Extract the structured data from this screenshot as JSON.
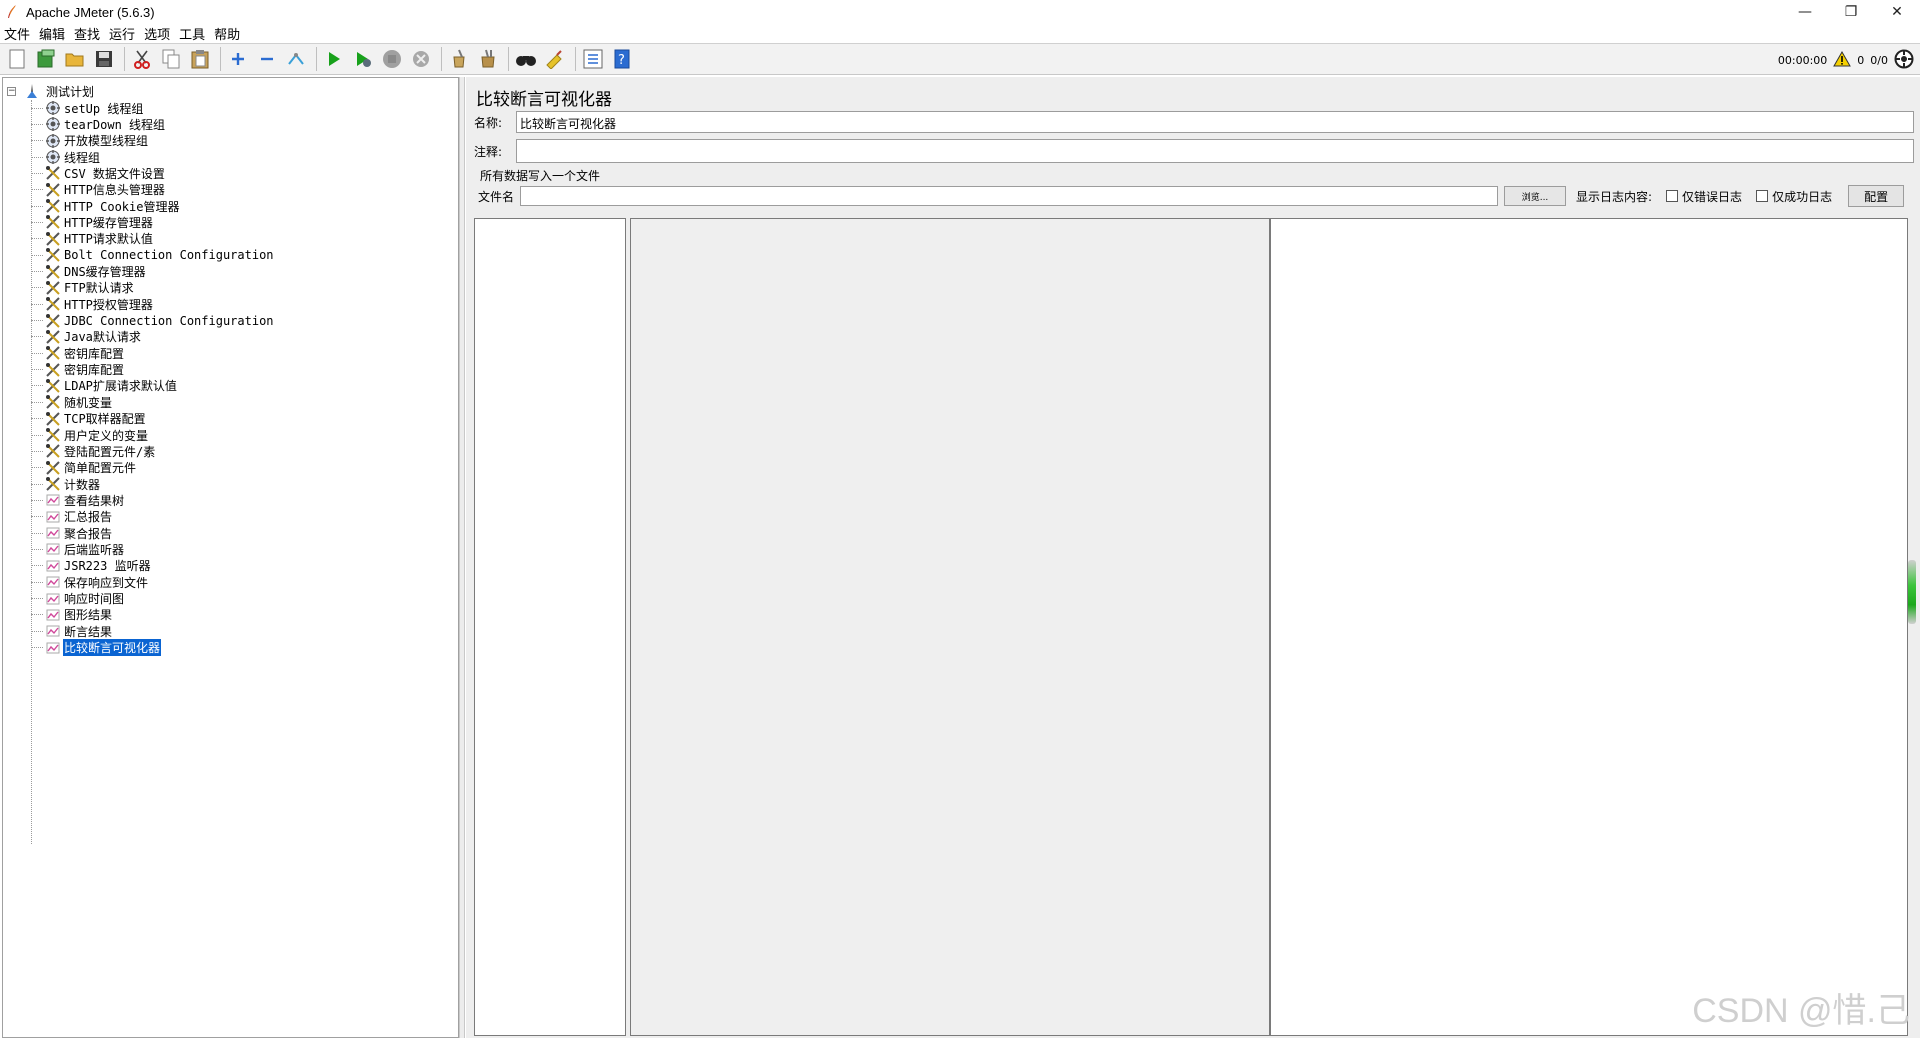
{
  "window": {
    "title": "Apache JMeter (5.6.3)",
    "minimize": "—",
    "restore": "❐",
    "close": "✕"
  },
  "menu": [
    "文件",
    "编辑",
    "查找",
    "运行",
    "选项",
    "工具",
    "帮助"
  ],
  "toolbar": {
    "icons": [
      "new-icon",
      "templates-icon",
      "open-icon",
      "save-icon",
      "cut-icon",
      "copy-icon",
      "paste-icon",
      "expand-icon",
      "collapse-icon",
      "toggle-icon",
      "start-icon",
      "start-no-pause-icon",
      "stop-icon",
      "shutdown-icon",
      "clear-icon",
      "clear-all-icon",
      "search-icon",
      "reset-search-icon",
      "function-helper-icon",
      "help-icon"
    ],
    "timer": "00:00:00",
    "warnings": "0",
    "threads": "0/0"
  },
  "tree": {
    "root": "测试计划",
    "items": [
      {
        "label": "setUp 线程组",
        "icon": "thread-group"
      },
      {
        "label": "tearDown 线程组",
        "icon": "thread-group"
      },
      {
        "label": "开放模型线程组",
        "icon": "thread-group"
      },
      {
        "label": "线程组",
        "icon": "thread-group"
      },
      {
        "label": "CSV 数据文件设置",
        "icon": "config"
      },
      {
        "label": "HTTP信息头管理器",
        "icon": "config"
      },
      {
        "label": "HTTP Cookie管理器",
        "icon": "config"
      },
      {
        "label": "HTTP缓存管理器",
        "icon": "config"
      },
      {
        "label": "HTTP请求默认值",
        "icon": "config"
      },
      {
        "label": "Bolt Connection Configuration",
        "icon": "config"
      },
      {
        "label": "DNS缓存管理器",
        "icon": "config"
      },
      {
        "label": "FTP默认请求",
        "icon": "config"
      },
      {
        "label": "HTTP授权管理器",
        "icon": "config"
      },
      {
        "label": "JDBC Connection Configuration",
        "icon": "config"
      },
      {
        "label": "Java默认请求",
        "icon": "config"
      },
      {
        "label": "密钥库配置",
        "icon": "config"
      },
      {
        "label": "密钥库配置",
        "icon": "config"
      },
      {
        "label": "LDAP扩展请求默认值",
        "icon": "config"
      },
      {
        "label": "随机变量",
        "icon": "config"
      },
      {
        "label": "TCP取样器配置",
        "icon": "config"
      },
      {
        "label": "用户定义的变量",
        "icon": "config"
      },
      {
        "label": "登陆配置元件/素",
        "icon": "config"
      },
      {
        "label": "简单配置元件",
        "icon": "config"
      },
      {
        "label": "计数器",
        "icon": "config"
      },
      {
        "label": "查看结果树",
        "icon": "listener"
      },
      {
        "label": "汇总报告",
        "icon": "listener"
      },
      {
        "label": "聚合报告",
        "icon": "listener"
      },
      {
        "label": "后端监听器",
        "icon": "listener"
      },
      {
        "label": "JSR223 监听器",
        "icon": "listener"
      },
      {
        "label": "保存响应到文件",
        "icon": "listener"
      },
      {
        "label": "响应时间图",
        "icon": "listener"
      },
      {
        "label": "图形结果",
        "icon": "listener"
      },
      {
        "label": "断言结果",
        "icon": "listener"
      },
      {
        "label": "比较断言可视化器",
        "icon": "listener",
        "selected": true
      }
    ]
  },
  "panel": {
    "title": "比较断言可视化器",
    "name_label": "名称:",
    "name_value": "比较断言可视化器",
    "comment_label": "注释:",
    "comment_value": "",
    "file_group_legend": "所有数据写入一个文件",
    "filename_label": "文件名",
    "filename_value": "",
    "browse_label": "浏览...",
    "log_content_label": "显示日志内容:",
    "errors_only_label": "仅错误日志",
    "success_only_label": "仅成功日志",
    "config_label": "配置"
  },
  "watermark": "CSDN @惜.己"
}
